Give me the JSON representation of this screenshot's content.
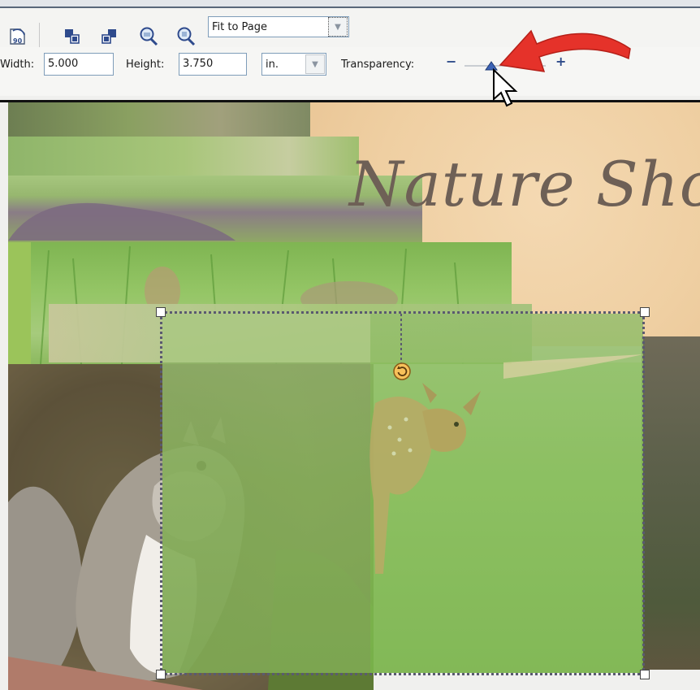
{
  "toolbar": {
    "zoom_select": {
      "value": "Fit to Page"
    },
    "icons": [
      "rotate-90-icon",
      "bring-forward-icon",
      "send-backward-icon",
      "zoom-in-icon",
      "zoom-out-icon"
    ]
  },
  "properties": {
    "width_label": "Width:",
    "width_value": "5.000",
    "height_label": "Height:",
    "height_value": "3.750",
    "unit_value": "in.",
    "transparency_label": "Transparency:",
    "transparency_minus": "−",
    "transparency_plus": "+"
  },
  "canvas": {
    "title": "Nature Shots"
  },
  "colors": {
    "accent": "#2f4c8a",
    "arrow_red": "#e5322a",
    "title_brown": "#6e6056"
  }
}
